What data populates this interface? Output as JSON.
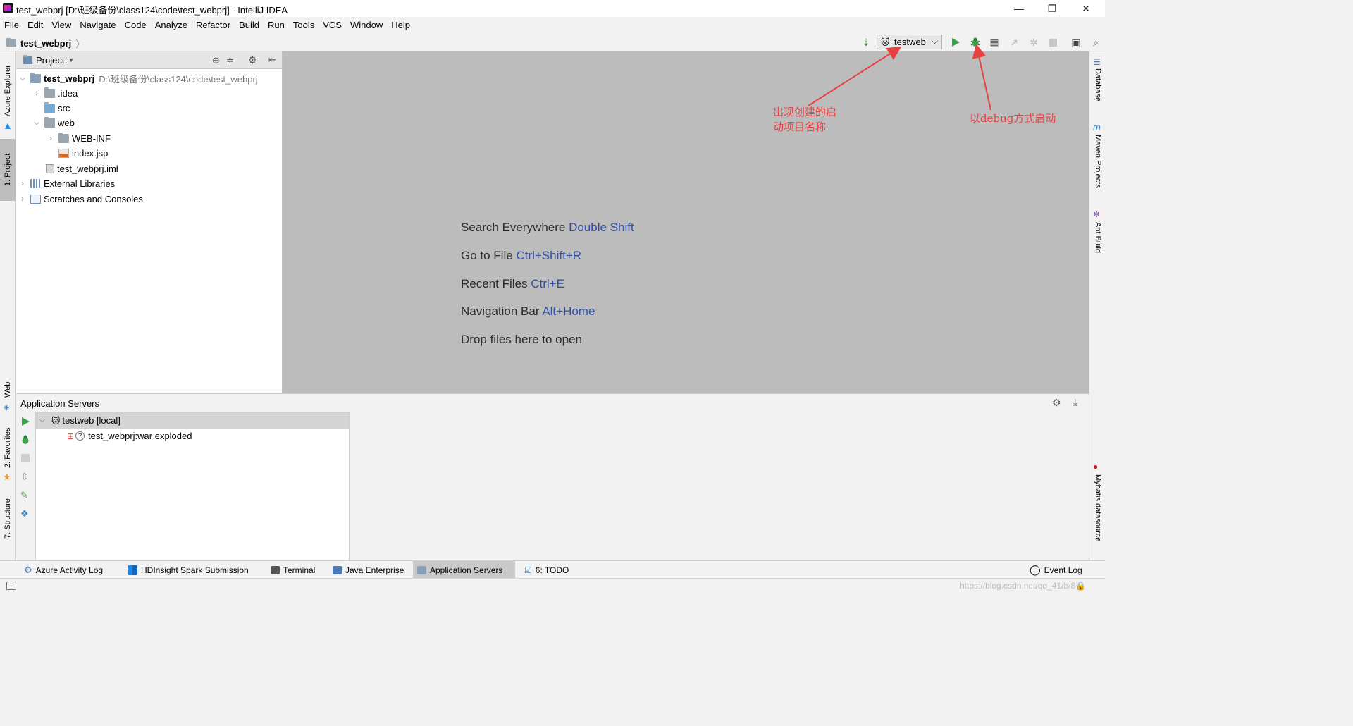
{
  "window": {
    "title": "test_webprj [D:\\班级备份\\class124\\code\\test_webprj] - IntelliJ IDEA",
    "minimize": "—",
    "restore": "❐",
    "close": "✕"
  },
  "menu": [
    "File",
    "Edit",
    "View",
    "Navigate",
    "Code",
    "Analyze",
    "Refactor",
    "Build",
    "Run",
    "Tools",
    "VCS",
    "Window",
    "Help"
  ],
  "breadcrumb": {
    "project": "test_webprj",
    "sep": "〉"
  },
  "toolbar": {
    "run_config": "testweb",
    "dropdown_arrow": "⌵"
  },
  "project_panel": {
    "title": "Project",
    "root": {
      "name": "test_webprj",
      "path": "D:\\班级备份\\class124\\code\\test_webprj"
    },
    "items": [
      ".idea",
      "src",
      "web",
      "WEB-INF",
      "index.jsp",
      "test_webprj.iml",
      "External Libraries",
      "Scratches and Consoles"
    ]
  },
  "left_tabs": [
    "Azure Explorer",
    "1: Project",
    "Web",
    "2: Favorites",
    "7: Structure"
  ],
  "right_tabs": [
    "Database",
    "Maven Projects",
    "Ant Build",
    "Mybatis datasource"
  ],
  "editor_hints": [
    {
      "text": "Search Everywhere",
      "key": "Double Shift"
    },
    {
      "text": "Go to File",
      "key": "Ctrl+Shift+R"
    },
    {
      "text": "Recent Files",
      "key": "Ctrl+E"
    },
    {
      "text": "Navigation Bar",
      "key": "Alt+Home"
    },
    {
      "text": "Drop files here to open",
      "key": ""
    }
  ],
  "annotations": {
    "config_note_line1": "出现创建的启",
    "config_note_line2": "动项目名称",
    "debug_note": "以debug方式启动",
    "color": "#e84141"
  },
  "app_servers": {
    "title": "Application Servers",
    "server": "testweb [local]",
    "artifact": "test_webprj:war exploded"
  },
  "bottom_tabs": [
    "Azure Activity Log",
    "HDInsight Spark Submission",
    "Terminal",
    "Java Enterprise",
    "Application Servers",
    "6: TODO"
  ],
  "event_log": "Event Log",
  "watermark": "https://blog.csdn.net/qq_41/b/8"
}
